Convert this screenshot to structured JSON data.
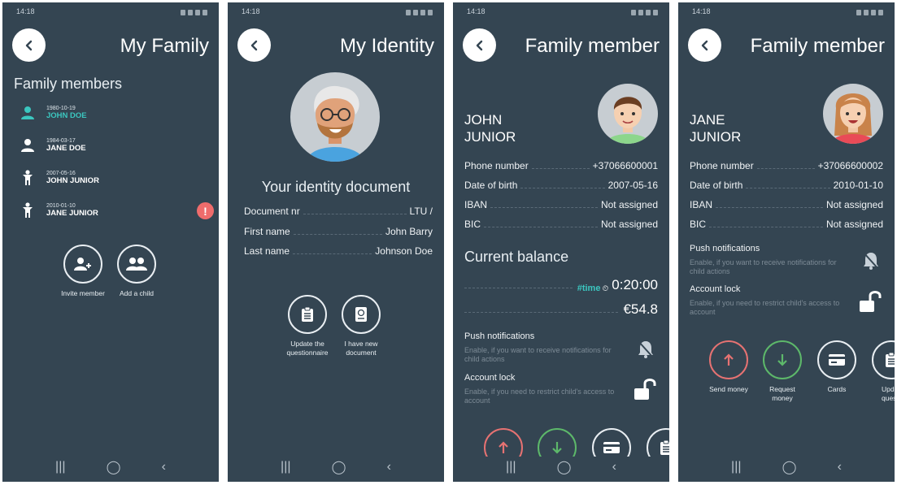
{
  "status_time": "14:18",
  "screens": {
    "family": {
      "title": "My Family",
      "section": "Family members",
      "members": [
        {
          "date": "1980-10-19",
          "name": "JOHN DOE"
        },
        {
          "date": "1984-03-17",
          "name": "JANE DOE"
        },
        {
          "date": "2007-05-16",
          "name": "JOHN JUNIOR"
        },
        {
          "date": "2010-01-10",
          "name": "JANE JUNIOR"
        }
      ],
      "alert_glyph": "!",
      "buttons": {
        "invite": "Invite member",
        "add_child": "Add a child"
      }
    },
    "identity": {
      "title": "My Identity",
      "section": "Your identity document",
      "rows": [
        {
          "label": "Document nr",
          "value": "LTU /"
        },
        {
          "label": "First name",
          "value": "John Barry"
        },
        {
          "label": "Last name",
          "value": "Johnson Doe"
        }
      ],
      "buttons": {
        "update_line1": "Update the",
        "update_line2": "questionnaire",
        "newdoc_line1": "I have new",
        "newdoc_line2": "document"
      }
    },
    "john_junior": {
      "title": "Family member",
      "name_line1": "JOHN",
      "name_line2": "JUNIOR",
      "rows": [
        {
          "label": "Phone number",
          "value": "+37066600001"
        },
        {
          "label": "Date of birth",
          "value": "2007-05-16"
        },
        {
          "label": "IBAN",
          "value": "Not assigned"
        },
        {
          "label": "BIC",
          "value": "Not assigned"
        }
      ],
      "balance_title": "Current balance",
      "time_tag": "#time",
      "time_value": "0:20:00",
      "money_value": "€54.8",
      "push_title": "Push notifications",
      "push_desc": "Enable, if you want to receive notifications for child actions",
      "lock_title": "Account lock",
      "lock_desc": "Enable, if you need to restrict child's access to account"
    },
    "jane_junior": {
      "title": "Family member",
      "name_line1": "JANE",
      "name_line2": "JUNIOR",
      "rows": [
        {
          "label": "Phone number",
          "value": "+37066600002"
        },
        {
          "label": "Date of birth",
          "value": "2010-01-10"
        },
        {
          "label": "IBAN",
          "value": "Not assigned"
        },
        {
          "label": "BIC",
          "value": "Not assigned"
        }
      ],
      "push_title": "Push notifications",
      "push_desc": "Enable, if you want to receive notifications for child actions",
      "lock_title": "Account lock",
      "lock_desc": "Enable, if you need to restrict child's access to account",
      "buttons": {
        "send_money": "Send money",
        "request_line1": "Request",
        "request_line2": "money",
        "cards": "Cards",
        "update_line1": "Update",
        "update_line2": "questio"
      }
    }
  },
  "colors": {
    "background": "#344552",
    "accent": "#3bc7c0",
    "alert": "#ef6c6c",
    "send": "#e67272",
    "request": "#5db86a"
  }
}
